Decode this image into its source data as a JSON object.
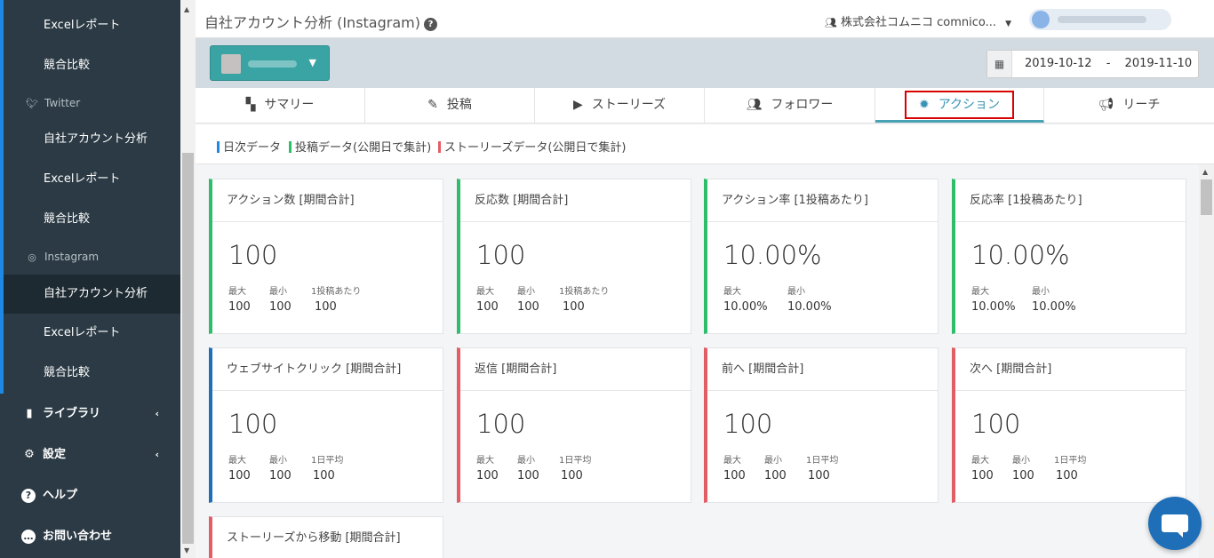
{
  "sidebar": {
    "twitter_items": [
      "Excelレポート",
      "競合比較"
    ],
    "twitter_head": "Twitter",
    "twitter_sub": [
      "自社アカウント分析",
      "Excelレポート",
      "競合比較"
    ],
    "instagram_head": "Instagram",
    "instagram_sub": [
      "自社アカウント分析",
      "Excelレポート",
      "競合比較"
    ],
    "library": "ライブラリ",
    "settings": "設定",
    "help": "ヘルプ",
    "contact": "お問い合わせ"
  },
  "header": {
    "title": "自社アカウント分析 (Instagram)",
    "help_icon": "?",
    "company": "株式会社コムニコ comnico..."
  },
  "toolbar": {
    "date_from": "2019-10-12",
    "date_sep": "-",
    "date_to": "2019-11-10"
  },
  "tabs": [
    {
      "label": "サマリー",
      "icon": "dashboard-icon"
    },
    {
      "label": "投稿",
      "icon": "post-icon"
    },
    {
      "label": "ストーリーズ",
      "icon": "play-icon"
    },
    {
      "label": "フォロワー",
      "icon": "people-icon"
    },
    {
      "label": "アクション",
      "icon": "action-badge-icon",
      "active": true
    },
    {
      "label": "リーチ",
      "icon": "megaphone-icon"
    }
  ],
  "legend": [
    {
      "label": "日次データ",
      "color": "#1e88e5"
    },
    {
      "label": "投稿データ(公開日で集計)",
      "color": "#2ebd6b"
    },
    {
      "label": "ストーリーズデータ(公開日で集計)",
      "color": "#e35d65"
    }
  ],
  "cards": [
    {
      "title": "アクション数 [期間合計]",
      "value": "100",
      "stats": [
        {
          "label": "最大",
          "value": "100"
        },
        {
          "label": "最小",
          "value": "100"
        },
        {
          "label": "1投稿あたり",
          "value": "100"
        }
      ],
      "color": "#2ebd6b"
    },
    {
      "title": "反応数 [期間合計]",
      "value": "100",
      "stats": [
        {
          "label": "最大",
          "value": "100"
        },
        {
          "label": "最小",
          "value": "100"
        },
        {
          "label": "1投稿あたり",
          "value": "100"
        }
      ],
      "color": "#2ebd6b"
    },
    {
      "title": "アクション率 [1投稿あたり]",
      "value": "10.00%",
      "stats": [
        {
          "label": "最大",
          "value": "10.00%"
        },
        {
          "label": "最小",
          "value": "10.00%"
        }
      ],
      "color": "#2ebd6b"
    },
    {
      "title": "反応率 [1投稿あたり]",
      "value": "10.00%",
      "stats": [
        {
          "label": "最大",
          "value": "10.00%"
        },
        {
          "label": "最小",
          "value": "10.00%"
        }
      ],
      "color": "#2ebd6b"
    },
    {
      "title": "ウェブサイトクリック [期間合計]",
      "value": "100",
      "stats": [
        {
          "label": "最大",
          "value": "100"
        },
        {
          "label": "最小",
          "value": "100"
        },
        {
          "label": "1日平均",
          "value": "100"
        }
      ],
      "color": "#1e6fb8"
    },
    {
      "title": "返信 [期間合計]",
      "value": "100",
      "stats": [
        {
          "label": "最大",
          "value": "100"
        },
        {
          "label": "最小",
          "value": "100"
        },
        {
          "label": "1日平均",
          "value": "100"
        }
      ],
      "color": "#e35d65"
    },
    {
      "title": "前へ [期間合計]",
      "value": "100",
      "stats": [
        {
          "label": "最大",
          "value": "100"
        },
        {
          "label": "最小",
          "value": "100"
        },
        {
          "label": "1日平均",
          "value": "100"
        }
      ],
      "color": "#e35d65"
    },
    {
      "title": "次へ [期間合計]",
      "value": "100",
      "stats": [
        {
          "label": "最大",
          "value": "100"
        },
        {
          "label": "最小",
          "value": "100"
        },
        {
          "label": "1日平均",
          "value": "100"
        }
      ],
      "color": "#e35d65"
    },
    {
      "title": "ストーリーズから移動 [期間合計]",
      "value": "",
      "stats": [],
      "color": "#e35d65"
    }
  ]
}
